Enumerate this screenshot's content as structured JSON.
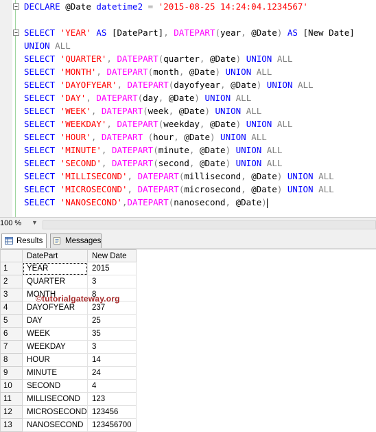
{
  "editor": {
    "lines": [
      [
        [
          "kw",
          "DECLARE "
        ],
        [
          "tx",
          "@Date "
        ],
        [
          "kw",
          "datetime2 "
        ],
        [
          "gr",
          "= "
        ],
        [
          "str",
          "'2015-08-25 14:24:04.1234567'"
        ]
      ],
      [],
      [
        [
          "kw",
          "SELECT "
        ],
        [
          "str",
          "'YEAR' "
        ],
        [
          "kw",
          "AS "
        ],
        [
          "tx",
          "[DatePart]"
        ],
        [
          "gr",
          ", "
        ],
        [
          "fn",
          "DATEPART"
        ],
        [
          "gr",
          "("
        ],
        [
          "tx",
          "year"
        ],
        [
          "gr",
          ", "
        ],
        [
          "tx",
          "@Date"
        ],
        [
          "gr",
          ") "
        ],
        [
          "kw",
          "AS "
        ],
        [
          "tx",
          "[New Date]"
        ]
      ],
      [
        [
          "kw",
          "UNION "
        ],
        [
          "gr",
          "ALL"
        ]
      ],
      [
        [
          "kw",
          "SELECT "
        ],
        [
          "str",
          "'QUARTER'"
        ],
        [
          "gr",
          ", "
        ],
        [
          "fn",
          "DATEPART"
        ],
        [
          "gr",
          "("
        ],
        [
          "tx",
          "quarter"
        ],
        [
          "gr",
          ", "
        ],
        [
          "tx",
          "@Date"
        ],
        [
          "gr",
          ") "
        ],
        [
          "kw",
          "UNION "
        ],
        [
          "gr",
          "ALL"
        ]
      ],
      [
        [
          "kw",
          "SELECT "
        ],
        [
          "str",
          "'MONTH'"
        ],
        [
          "gr",
          ", "
        ],
        [
          "fn",
          "DATEPART"
        ],
        [
          "gr",
          "("
        ],
        [
          "tx",
          "month"
        ],
        [
          "gr",
          ", "
        ],
        [
          "tx",
          "@Date"
        ],
        [
          "gr",
          ") "
        ],
        [
          "kw",
          "UNION "
        ],
        [
          "gr",
          "ALL"
        ]
      ],
      [
        [
          "kw",
          "SELECT "
        ],
        [
          "str",
          "'DAYOFYEAR'"
        ],
        [
          "gr",
          ", "
        ],
        [
          "fn",
          "DATEPART"
        ],
        [
          "gr",
          "("
        ],
        [
          "tx",
          "dayofyear"
        ],
        [
          "gr",
          ", "
        ],
        [
          "tx",
          "@Date"
        ],
        [
          "gr",
          ") "
        ],
        [
          "kw",
          "UNION "
        ],
        [
          "gr",
          "ALL"
        ]
      ],
      [
        [
          "kw",
          "SELECT "
        ],
        [
          "str",
          "'DAY'"
        ],
        [
          "gr",
          ", "
        ],
        [
          "fn",
          "DATEPART"
        ],
        [
          "gr",
          "("
        ],
        [
          "tx",
          "day"
        ],
        [
          "gr",
          ", "
        ],
        [
          "tx",
          "@Date"
        ],
        [
          "gr",
          ") "
        ],
        [
          "kw",
          "UNION "
        ],
        [
          "gr",
          "ALL"
        ]
      ],
      [
        [
          "kw",
          "SELECT "
        ],
        [
          "str",
          "'WEEK'"
        ],
        [
          "gr",
          ", "
        ],
        [
          "fn",
          "DATEPART"
        ],
        [
          "gr",
          "("
        ],
        [
          "tx",
          "week"
        ],
        [
          "gr",
          ", "
        ],
        [
          "tx",
          "@Date"
        ],
        [
          "gr",
          ") "
        ],
        [
          "kw",
          "UNION "
        ],
        [
          "gr",
          "ALL"
        ]
      ],
      [
        [
          "kw",
          "SELECT "
        ],
        [
          "str",
          "'WEEKDAY'"
        ],
        [
          "gr",
          ", "
        ],
        [
          "fn",
          "DATEPART"
        ],
        [
          "gr",
          "("
        ],
        [
          "tx",
          "weekday"
        ],
        [
          "gr",
          ", "
        ],
        [
          "tx",
          "@Date"
        ],
        [
          "gr",
          ") "
        ],
        [
          "kw",
          "UNION "
        ],
        [
          "gr",
          "ALL"
        ]
      ],
      [
        [
          "kw",
          "SELECT "
        ],
        [
          "str",
          "'HOUR'"
        ],
        [
          "gr",
          ", "
        ],
        [
          "fn",
          "DATEPART "
        ],
        [
          "gr",
          "("
        ],
        [
          "tx",
          "hour"
        ],
        [
          "gr",
          ", "
        ],
        [
          "tx",
          "@Date"
        ],
        [
          "gr",
          ") "
        ],
        [
          "kw",
          "UNION "
        ],
        [
          "gr",
          "ALL"
        ]
      ],
      [
        [
          "kw",
          "SELECT "
        ],
        [
          "str",
          "'MINUTE'"
        ],
        [
          "gr",
          ", "
        ],
        [
          "fn",
          "DATEPART"
        ],
        [
          "gr",
          "("
        ],
        [
          "tx",
          "minute"
        ],
        [
          "gr",
          ", "
        ],
        [
          "tx",
          "@Date"
        ],
        [
          "gr",
          ") "
        ],
        [
          "kw",
          "UNION "
        ],
        [
          "gr",
          "ALL"
        ]
      ],
      [
        [
          "kw",
          "SELECT "
        ],
        [
          "str",
          "'SECOND'"
        ],
        [
          "gr",
          ", "
        ],
        [
          "fn",
          "DATEPART"
        ],
        [
          "gr",
          "("
        ],
        [
          "tx",
          "second"
        ],
        [
          "gr",
          ", "
        ],
        [
          "tx",
          "@Date"
        ],
        [
          "gr",
          ") "
        ],
        [
          "kw",
          "UNION "
        ],
        [
          "gr",
          "ALL"
        ]
      ],
      [
        [
          "kw",
          "SELECT "
        ],
        [
          "str",
          "'MILLISECOND'"
        ],
        [
          "gr",
          ", "
        ],
        [
          "fn",
          "DATEPART"
        ],
        [
          "gr",
          "("
        ],
        [
          "tx",
          "millisecond"
        ],
        [
          "gr",
          ", "
        ],
        [
          "tx",
          "@Date"
        ],
        [
          "gr",
          ") "
        ],
        [
          "kw",
          "UNION "
        ],
        [
          "gr",
          "ALL"
        ]
      ],
      [
        [
          "kw",
          "SELECT "
        ],
        [
          "str",
          "'MICROSECOND'"
        ],
        [
          "gr",
          ", "
        ],
        [
          "fn",
          "DATEPART"
        ],
        [
          "gr",
          "("
        ],
        [
          "tx",
          "microsecond"
        ],
        [
          "gr",
          ", "
        ],
        [
          "tx",
          "@Date"
        ],
        [
          "gr",
          ") "
        ],
        [
          "kw",
          "UNION "
        ],
        [
          "gr",
          "ALL"
        ]
      ],
      [
        [
          "kw",
          "SELECT "
        ],
        [
          "str",
          "'NANOSECOND'"
        ],
        [
          "gr",
          ","
        ],
        [
          "fn",
          "DATEPART"
        ],
        [
          "gr",
          "("
        ],
        [
          "tx",
          "nanosecond"
        ],
        [
          "gr",
          ", "
        ],
        [
          "tx",
          "@Date"
        ],
        [
          "gr",
          ")"
        ]
      ]
    ]
  },
  "zoom": {
    "value": "100 %"
  },
  "tabs": {
    "results": "Results",
    "messages": "Messages"
  },
  "grid": {
    "columns": [
      "DatePart",
      "New Date"
    ],
    "rows": [
      [
        "1",
        "YEAR",
        "2015"
      ],
      [
        "2",
        "QUARTER",
        "3"
      ],
      [
        "3",
        "MONTH",
        "8"
      ],
      [
        "4",
        "DAYOFYEAR",
        "237"
      ],
      [
        "5",
        "DAY",
        "25"
      ],
      [
        "6",
        "WEEK",
        "35"
      ],
      [
        "7",
        "WEEKDAY",
        "3"
      ],
      [
        "8",
        "HOUR",
        "14"
      ],
      [
        "9",
        "MINUTE",
        "24"
      ],
      [
        "10",
        "SECOND",
        "4"
      ],
      [
        "11",
        "MILLISECOND",
        "123"
      ],
      [
        "12",
        "MICROSECOND",
        "123456"
      ],
      [
        "13",
        "NANOSECOND",
        "123456700"
      ]
    ]
  },
  "watermark": {
    "symbol": "©",
    "text": "tutorialgateway.org"
  },
  "colors": {
    "keyword": "#0000ff",
    "function": "#ff00ff",
    "string": "#ff0000",
    "operator": "#808080"
  }
}
